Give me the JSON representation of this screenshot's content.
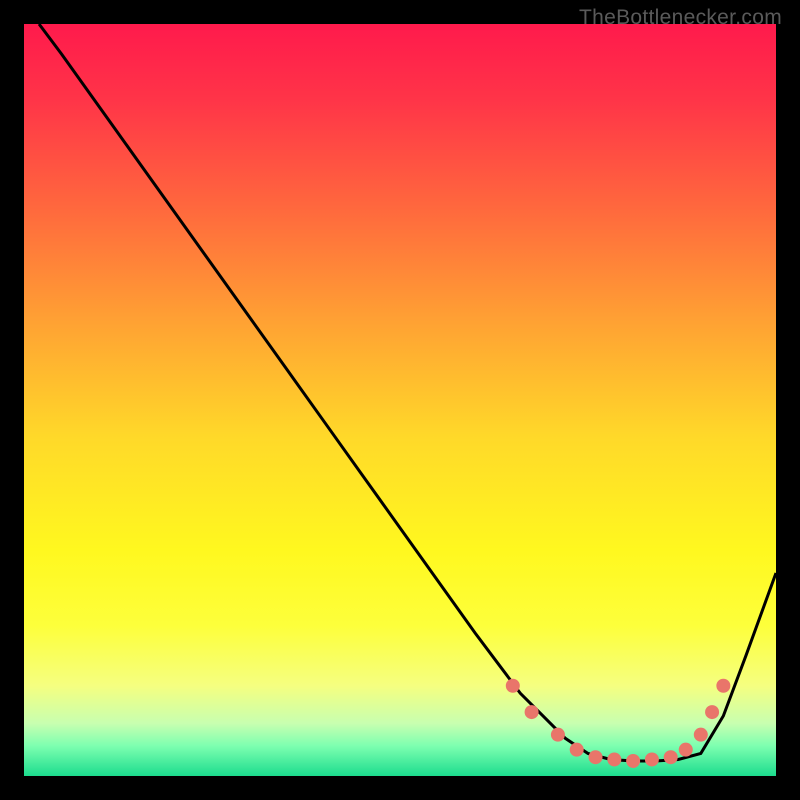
{
  "watermark": "TheBottleneсker.com",
  "chart_data": {
    "type": "line",
    "title": "",
    "xlabel": "",
    "ylabel": "",
    "xlim": [
      0,
      100
    ],
    "ylim": [
      0,
      100
    ],
    "grid": false,
    "background_gradient": {
      "stops": [
        {
          "pos": 0.0,
          "color": "#ff1a4c"
        },
        {
          "pos": 0.1,
          "color": "#ff3448"
        },
        {
          "pos": 0.25,
          "color": "#ff6a3d"
        },
        {
          "pos": 0.4,
          "color": "#ffa333"
        },
        {
          "pos": 0.55,
          "color": "#ffd929"
        },
        {
          "pos": 0.7,
          "color": "#fff81f"
        },
        {
          "pos": 0.8,
          "color": "#fdff3b"
        },
        {
          "pos": 0.88,
          "color": "#f5ff80"
        },
        {
          "pos": 0.93,
          "color": "#c8ffb0"
        },
        {
          "pos": 0.96,
          "color": "#7dffb0"
        },
        {
          "pos": 1.0,
          "color": "#1cdc8e"
        }
      ]
    },
    "series": [
      {
        "name": "bottleneck-curve",
        "x": [
          2,
          5,
          10,
          15,
          20,
          25,
          30,
          35,
          40,
          45,
          50,
          55,
          60,
          63,
          66,
          69,
          72,
          75,
          78,
          81,
          84,
          87,
          90,
          93,
          96,
          100
        ],
        "y": [
          100,
          96,
          89,
          82,
          75,
          68,
          61,
          54,
          47,
          40,
          33,
          26,
          19,
          15,
          11,
          8,
          5,
          3,
          2.2,
          2.0,
          2.0,
          2.2,
          3,
          8,
          16,
          27
        ]
      }
    ],
    "markers": {
      "name": "highlight-dots",
      "color": "#e9756a",
      "radius": 7,
      "points": [
        {
          "x": 65,
          "y": 12
        },
        {
          "x": 67.5,
          "y": 8.5
        },
        {
          "x": 71,
          "y": 5.5
        },
        {
          "x": 73.5,
          "y": 3.5
        },
        {
          "x": 76,
          "y": 2.5
        },
        {
          "x": 78.5,
          "y": 2.2
        },
        {
          "x": 81,
          "y": 2.0
        },
        {
          "x": 83.5,
          "y": 2.2
        },
        {
          "x": 86,
          "y": 2.5
        },
        {
          "x": 88,
          "y": 3.5
        },
        {
          "x": 90,
          "y": 5.5
        },
        {
          "x": 91.5,
          "y": 8.5
        },
        {
          "x": 93,
          "y": 12
        }
      ]
    }
  }
}
